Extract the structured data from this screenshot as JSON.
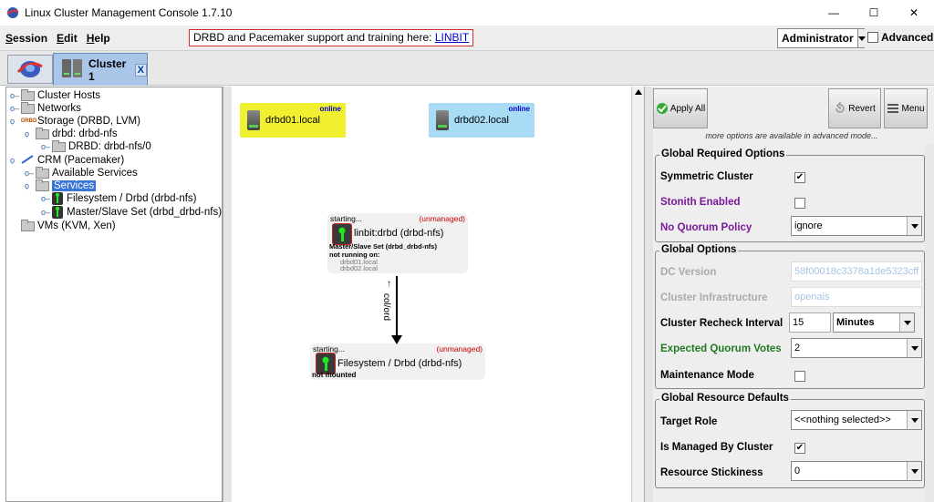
{
  "window": {
    "title": "Linux Cluster Management Console 1.7.10",
    "minimize_glyph": "—",
    "maximize_glyph": "☐",
    "close_glyph": "✕"
  },
  "menubar": {
    "session_mnemonic": "S",
    "session_rest": "ession",
    "edit_mnemonic": "E",
    "edit_rest": "dit",
    "help_mnemonic": "H",
    "help_rest": "elp",
    "banner_text": "DRBD and Pacemaker support and training here: ",
    "banner_link": "LINBIT",
    "user_mode": "Administrator",
    "advanced_label": "Advanced"
  },
  "tabs": {
    "cluster_label": "Cluster 1",
    "close_label": "X"
  },
  "tree": {
    "cluster_hosts": "Cluster Hosts",
    "networks": "Networks",
    "storage": "Storage (DRBD, LVM)",
    "drbd_resource": "drbd: drbd-nfs",
    "drbd_volume": "DRBD: drbd-nfs/0",
    "crm": "CRM (Pacemaker)",
    "available_services": "Available Services",
    "services": "Services",
    "svc_filesystem": "Filesystem / Drbd (drbd-nfs)",
    "svc_masterslave": "Master/Slave Set (drbd_drbd-nfs)",
    "vms": "VMs (KVM, Xen)"
  },
  "graph": {
    "host1": {
      "name": "drbd01.local",
      "status": "online",
      "color": "#f0f030"
    },
    "host2": {
      "name": "drbd02.local",
      "status": "online",
      "color": "#a8dcf4"
    },
    "ms": {
      "state": "starting...",
      "managed": "(unmanaged)",
      "name": "linbit:drbd (drbd-nfs)",
      "set_label": "Master/Slave Set (drbd_drbd-nfs)",
      "not_running": "not running on:",
      "node1": "drbd01.local",
      "node2": "drbd02.local"
    },
    "edge_label": "col/ord",
    "edge_up_glyph": "↑",
    "fs": {
      "state": "starting...",
      "managed": "(unmanaged)",
      "name": "Filesystem / Drbd (drbd-nfs)",
      "sub": "not mounted"
    }
  },
  "toolbar": {
    "apply_all": "Apply All",
    "revert": "Revert",
    "menu": "Menu",
    "advanced_note": "more options are available in advanced mode..."
  },
  "global_required": {
    "title": "Global Required Options",
    "symmetric_label": "Symmetric Cluster",
    "symmetric_checked": "✔",
    "stonith_label": "Stonith Enabled",
    "no_quorum_label": "No Quorum Policy",
    "no_quorum_value": "ignore"
  },
  "global_options": {
    "title": "Global Options",
    "dc_version_label": "DC Version",
    "dc_version_value": "58f00018c3378a1de5323cff",
    "infra_label": "Cluster Infrastructure",
    "infra_value": "openais",
    "recheck_label": "Cluster Recheck Interval",
    "recheck_value": "15",
    "recheck_unit": "Minutes",
    "expected_label": "Expected Quorum Votes",
    "expected_value": "2",
    "maint_label": "Maintenance Mode"
  },
  "resource_defaults": {
    "title": "Global Resource Defaults",
    "target_role_label": "Target Role",
    "target_role_value": "<<nothing selected>>",
    "managed_label": "Is Managed By Cluster",
    "managed_checked": "✔",
    "stickiness_label": "Resource Stickiness",
    "stickiness_value": "0"
  }
}
